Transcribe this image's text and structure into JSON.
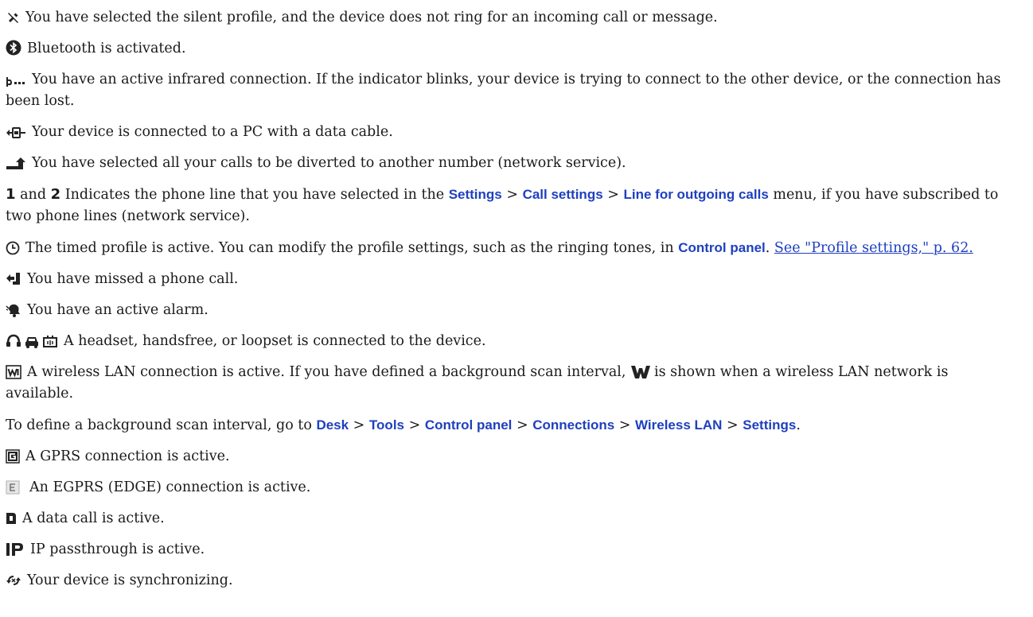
{
  "items": {
    "silent": {
      "icon": "silent-profile-icon",
      "text": "You have selected the silent profile, and the device does not ring for an incoming call or message."
    },
    "bluetooth": {
      "icon": "bluetooth-icon",
      "text": "Bluetooth is activated."
    },
    "infrared": {
      "icon": "infrared-icon",
      "text": "You have an active infrared connection. If the indicator blinks, your device is trying to connect to the other device, or the connection has been lost."
    },
    "datacable": {
      "icon": "data-cable-icon",
      "text": "Your device is connected to a PC with a data cable."
    },
    "divert": {
      "icon": "call-divert-icon",
      "text": "You have selected all your calls to be diverted to another number (network service)."
    },
    "line": {
      "icon1": "1",
      "and": "and",
      "icon2": "2",
      "text_before": "Indicates the phone line that you have selected in the",
      "menu_settings": "Settings",
      "sep": ">",
      "menu_call_settings": "Call settings",
      "menu_line_outgoing": "Line for outgoing calls",
      "text_after": "menu, if you have subscribed to two phone lines (network service)."
    },
    "timed": {
      "icon": "timed-profile-icon",
      "text_before": "The timed profile is active. You can modify the profile settings, such as the ringing tones, in",
      "menu_control_panel": "Control panel",
      "period": ".",
      "link": "See \"Profile settings,\" p. 62."
    },
    "missed": {
      "icon": "missed-call-icon",
      "text": "You have missed a phone call."
    },
    "alarm": {
      "icon": "alarm-icon",
      "text": "You have an active alarm."
    },
    "headset": {
      "icons": [
        "headset-icon",
        "handsfree-icon",
        "loopset-icon"
      ],
      "text": "A headset, handsfree, or loopset is connected to the device."
    },
    "wlan": {
      "icon": "wlan-active-icon",
      "text_before": "A wireless LAN connection is active. If you have defined a background scan interval,",
      "icon2": "wlan-available-icon",
      "text_after": "is shown when a wireless LAN network is available."
    },
    "scan": {
      "text_before": "To define a background scan interval, go to",
      "path": [
        "Desk",
        "Tools",
        "Control panel",
        "Connections",
        "Wireless LAN",
        "Settings"
      ],
      "sep": ">",
      "period": "."
    },
    "gprs": {
      "icon": "gprs-icon",
      "text": "A GPRS connection is active."
    },
    "egprs": {
      "icon": "egprs-icon",
      "text": "An EGPRS (EDGE) connection is active."
    },
    "datacall": {
      "icon": "data-call-icon",
      "text": "A data call is active."
    },
    "ip": {
      "icon": "ip-passthrough-icon",
      "text": "IP passthrough is active."
    },
    "sync": {
      "icon": "synchronizing-icon",
      "text": "Your device is synchronizing."
    }
  },
  "colors": {
    "link": "#1f3fbf",
    "text": "#1a1a1a"
  }
}
